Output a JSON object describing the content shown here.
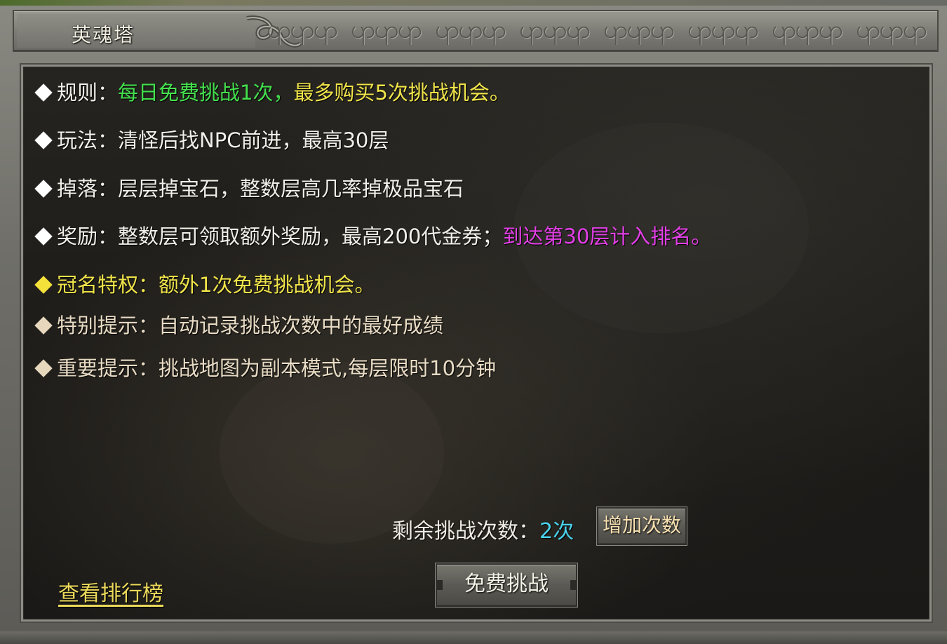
{
  "window": {
    "title": "英魂塔"
  },
  "rules": [
    {
      "label": "规则：",
      "segments": [
        {
          "text": "每日免费挑战1次，",
          "color": "green"
        },
        {
          "text": "最多购买5次挑战机会。",
          "color": "yellow"
        }
      ],
      "diamond": "white"
    },
    {
      "label": "玩法：",
      "segments": [
        {
          "text": "清怪后找NPC前进，最高30层",
          "color": "white"
        }
      ],
      "diamond": "white"
    },
    {
      "label": "掉落：",
      "segments": [
        {
          "text": "层层掉宝石，整数层高几率掉极品宝石",
          "color": "white"
        }
      ],
      "diamond": "white"
    },
    {
      "label": "奖励：",
      "segments": [
        {
          "text": "整数层可领取额外奖励，最高200代金券；",
          "color": "white"
        },
        {
          "text": "到达第30层计入排名。",
          "color": "magenta"
        }
      ],
      "diamond": "white"
    },
    {
      "label": "冠名特权：",
      "segments": [
        {
          "text": "额外1次免费挑战机会。",
          "color": "yellow"
        }
      ],
      "diamond": "yellow"
    },
    {
      "label": "特别提示：",
      "segments": [
        {
          "text": "自动记录挑战次数中的最好成绩",
          "color": "beige"
        }
      ],
      "diamond": "beige"
    },
    {
      "label": "重要提示：",
      "segments": [
        {
          "text": "挑战地图为副本模式,每层限时10分钟",
          "color": "beige"
        }
      ],
      "diamond": "beige"
    }
  ],
  "remaining": {
    "label": "剩余挑战次数：",
    "value": "2次"
  },
  "buttons": {
    "add_count": "增加次数",
    "free_challenge": "免费挑战",
    "view_ranking": "查看排行榜"
  },
  "colors": {
    "green": "#44e04e",
    "yellow": "#f0e44a",
    "magenta": "#e23fe6",
    "cyan": "#49d2ea",
    "beige": "#e9dcc5",
    "link": "#ecd95a"
  }
}
